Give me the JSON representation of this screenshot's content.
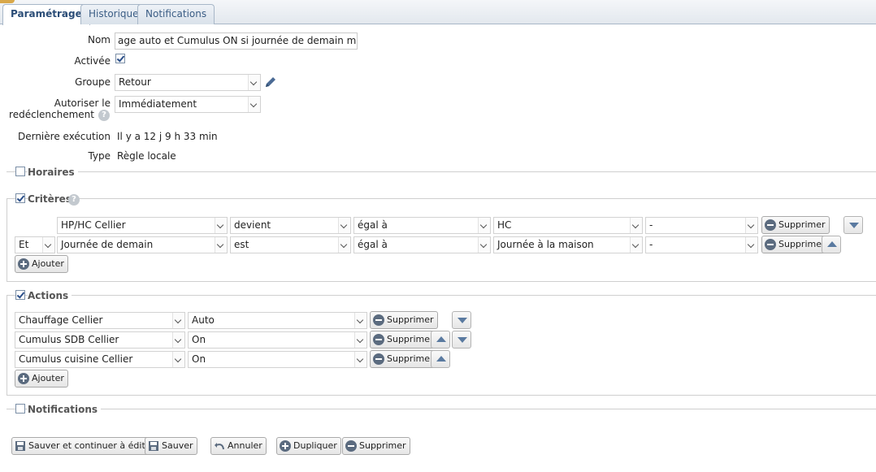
{
  "tabs": [
    {
      "label": "Paramétrage"
    },
    {
      "label": "Historique"
    },
    {
      "label": "Notifications"
    }
  ],
  "form": {
    "nom_label": "Nom",
    "nom_value": "age auto et Cumulus ON si journée de demain maison",
    "activee_label": "Activée",
    "activee_checked": true,
    "groupe_label": "Groupe",
    "groupe_value": "Retour",
    "autoriser_label_1": "Autoriser le",
    "autoriser_label_2": "redéclenchement",
    "autoriser_value": "Immédiatement",
    "derniere_label": "Dernière exécution",
    "derniere_value": "Il y a 12 j 9 h 33 min",
    "type_label": "Type",
    "type_value": "Règle locale"
  },
  "sections": {
    "horaires": {
      "label": "Horaires",
      "checked": false
    },
    "criteres": {
      "label": "Critères",
      "checked": true
    },
    "actions": {
      "label": "Actions",
      "checked": true
    },
    "notifications": {
      "label": "Notifications",
      "checked": false
    }
  },
  "criteres": [
    {
      "connector": "",
      "device": "HP/HC Cellier",
      "event": "devient",
      "operator": "égal à",
      "value": "HC",
      "extra": "-"
    },
    {
      "connector": "Et",
      "device": "Journée de demain",
      "event": "est",
      "operator": "égal à",
      "value": "Journée à la maison",
      "extra": "-"
    }
  ],
  "actions": [
    {
      "device": "Chauffage Cellier",
      "value": "Auto"
    },
    {
      "device": "Cumulus SDB Cellier",
      "value": "On"
    },
    {
      "device": "Cumulus cuisine Cellier",
      "value": "On"
    }
  ],
  "buttons": {
    "supprimer": "Supprimer",
    "ajouter": "Ajouter",
    "sauver_continuer": "Sauver et continuer à éditer",
    "sauver": "Sauver",
    "annuler": "Annuler",
    "dupliquer": "Dupliquer",
    "supprimer_rule": "Supprimer"
  },
  "help_glyph": "?",
  "colors": {
    "tab_text": "#3b5d85",
    "icon": "#5b6b7f",
    "arrow": "#5a7aa0",
    "pencil": "#4a6a94"
  }
}
